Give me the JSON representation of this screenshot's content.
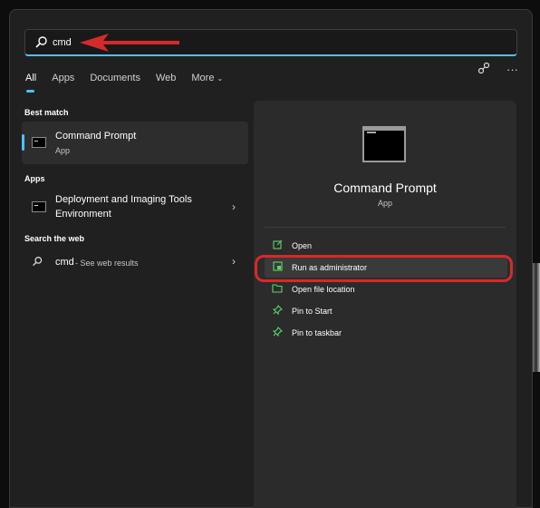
{
  "search": {
    "query": "cmd"
  },
  "tabs": [
    {
      "label": "All",
      "active": true
    },
    {
      "label": "Apps"
    },
    {
      "label": "Documents"
    },
    {
      "label": "Web"
    },
    {
      "label": "More"
    }
  ],
  "toolbar": {
    "share_icon": "share-icon",
    "more_icon": "more-icon",
    "more_glyph": "···"
  },
  "best_match": {
    "heading": "Best match",
    "title": "Command Prompt",
    "subtitle": "App"
  },
  "apps": {
    "heading": "Apps",
    "items": [
      {
        "line1": "Deployment and Imaging Tools",
        "line2": "Environment"
      }
    ]
  },
  "web": {
    "heading": "Search the web",
    "query": "cmd",
    "suffix": " - See web results"
  },
  "detail": {
    "title": "Command Prompt",
    "subtitle": "App",
    "actions": [
      {
        "label": "Open",
        "icon": "open-icon"
      },
      {
        "label": "Run as administrator",
        "icon": "shield-icon",
        "highlighted": true
      },
      {
        "label": "Open file location",
        "icon": "folder-icon"
      },
      {
        "label": "Pin to Start",
        "icon": "pin-icon"
      },
      {
        "label": "Pin to taskbar",
        "icon": "pin-icon"
      }
    ]
  },
  "colors": {
    "accent": "#4cc2ff",
    "annotation": "#d42a2a",
    "action_icon": "#5ed46a"
  }
}
